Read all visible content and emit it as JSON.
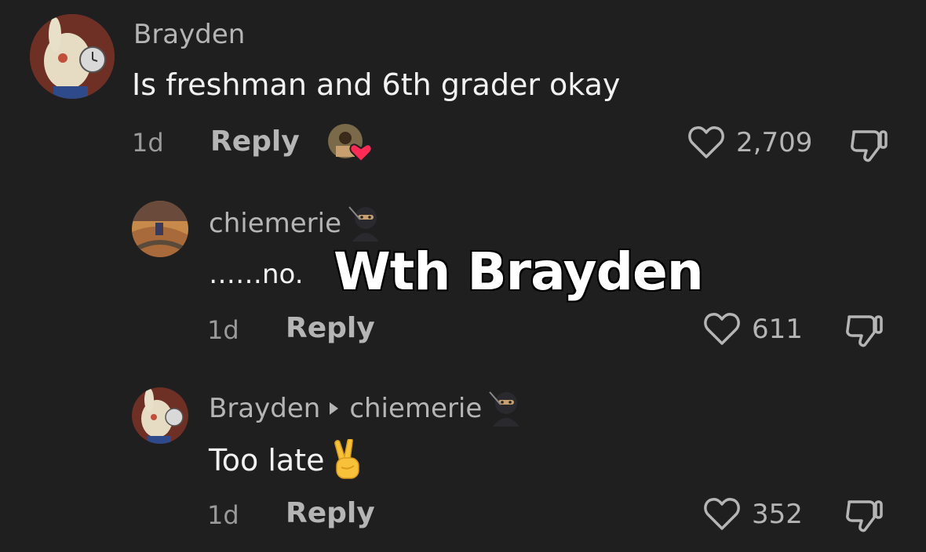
{
  "overlay": {
    "caption": "Wth Brayden"
  },
  "comments": [
    {
      "author": "Brayden",
      "text": "Is freshman and 6th grader okay",
      "time": "1d",
      "reply_label": "Reply",
      "likes": "2,709",
      "creator_liked": true
    },
    {
      "author": "chiemerie",
      "author_badge": "ninja-emoji",
      "text": "……no.",
      "time": "1d",
      "reply_label": "Reply",
      "likes": "611"
    },
    {
      "author": "Brayden",
      "replying_to": "chiemerie",
      "replying_to_badge": "ninja-emoji",
      "text": "Too late",
      "text_emoji": "victory-hand-emoji",
      "time": "1d",
      "reply_label": "Reply",
      "likes": "352"
    }
  ],
  "colors": {
    "background": "#1f1f1f",
    "secondary_text": "#b5b5b5",
    "heart_badge": "#fe2c55"
  }
}
